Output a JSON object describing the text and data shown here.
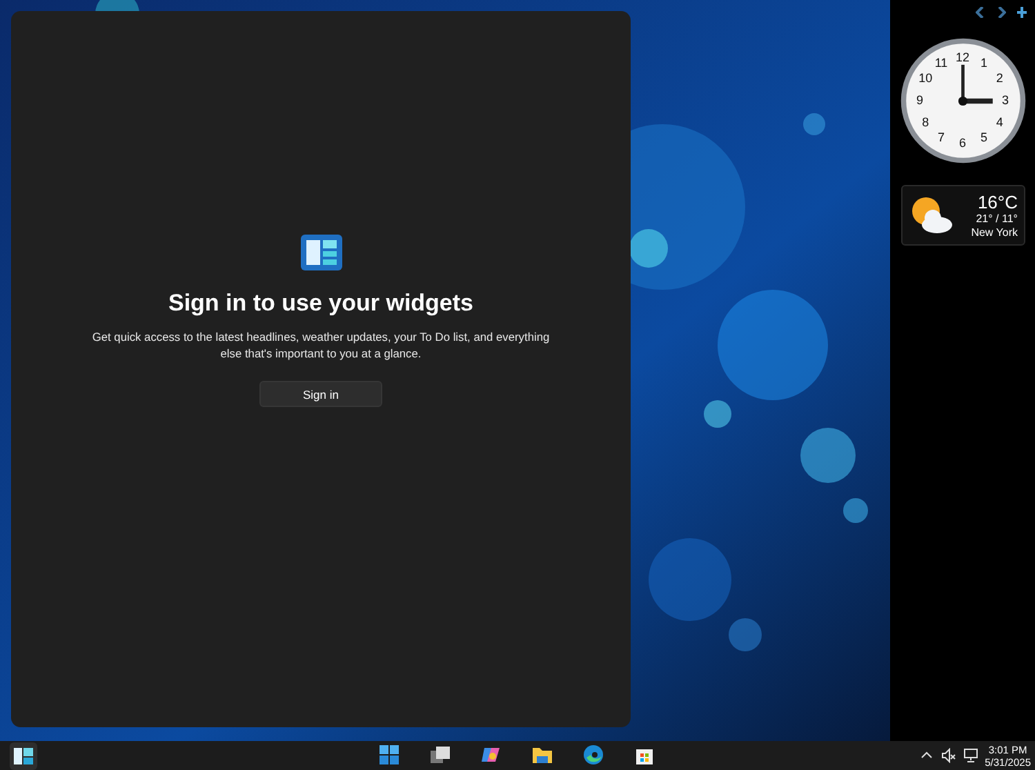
{
  "widgets_panel": {
    "title": "Sign in to use your widgets",
    "description": "Get quick access to the latest headlines, weather updates, your To Do list, and everything else that's important to you at a glance.",
    "button": "Sign in"
  },
  "gadgets": {
    "clock": {
      "numerals": [
        "12",
        "11",
        "1",
        "10",
        "2",
        "9",
        "3",
        "8",
        "4",
        "7",
        "5",
        "6"
      ]
    },
    "weather": {
      "temperature": "16°C",
      "range": "21° / 11°",
      "city": "New York"
    }
  },
  "taskbar": {
    "widgets_selected": true,
    "time": "3:01 PM",
    "date": "5/31/2025"
  }
}
